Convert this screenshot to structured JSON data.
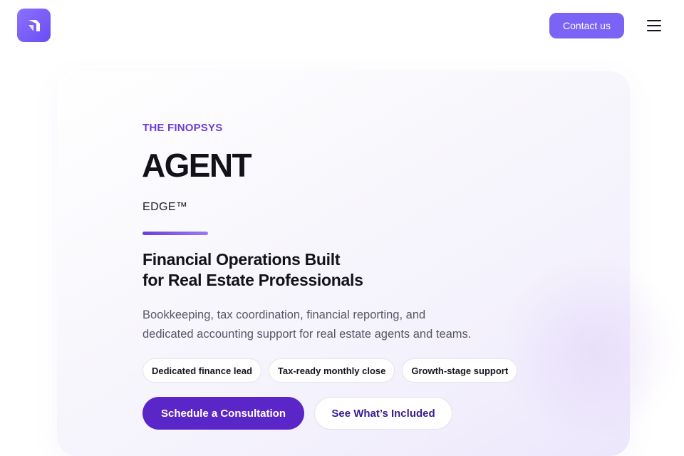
{
  "header": {
    "logo_icon": "brand-arrow-icon",
    "brand_color": "#7b63f6",
    "contact_label": "Contact us",
    "menu_icon": "hamburger-menu-icon"
  },
  "hero": {
    "eyebrow": "THE FINOPSYS",
    "title": "AGENT",
    "subtitle": "EDGE™",
    "headline_lines": [
      "Financial Operations Built",
      "for Real Estate Professionals"
    ],
    "description_lines": [
      "Bookkeeping, tax coordination, financial reporting, and",
      "dedicated accounting support for real estate agents and teams."
    ],
    "chips": [
      "Dedicated finance lead",
      "Tax-ready monthly close",
      "Growth-stage support"
    ],
    "primary_cta": "Schedule a Consultation",
    "secondary_cta": "See What’s Included",
    "accent_color": "#5b26c7"
  }
}
